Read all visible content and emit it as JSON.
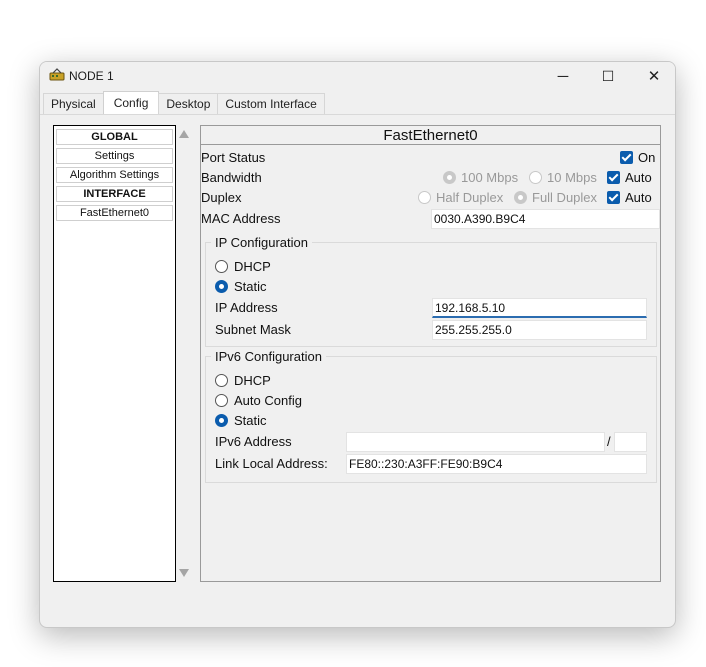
{
  "window": {
    "title": "NODE 1",
    "controls": {
      "minimize": "─",
      "maximize": "☐",
      "close": "✕"
    }
  },
  "tabs": [
    {
      "label": "Physical",
      "active": false
    },
    {
      "label": "Config",
      "active": true
    },
    {
      "label": "Desktop",
      "active": false
    },
    {
      "label": "Custom Interface",
      "active": false
    }
  ],
  "sidebar": {
    "items": [
      {
        "label": "GLOBAL",
        "bold": true
      },
      {
        "label": "Settings",
        "bold": false
      },
      {
        "label": "Algorithm Settings",
        "bold": false
      },
      {
        "label": "INTERFACE",
        "bold": true
      },
      {
        "label": "FastEthernet0",
        "bold": false
      }
    ]
  },
  "panel": {
    "title": "FastEthernet0",
    "port_status": {
      "label": "Port Status",
      "on_label": "On",
      "on": true
    },
    "bandwidth": {
      "label": "Bandwidth",
      "opt_100": "100 Mbps",
      "opt_10": "10 Mbps",
      "auto_label": "Auto",
      "auto": true
    },
    "duplex": {
      "label": "Duplex",
      "opt_half": "Half Duplex",
      "opt_full": "Full Duplex",
      "auto_label": "Auto",
      "auto": true
    },
    "mac": {
      "label": "MAC Address",
      "value": "0030.A390.B9C4"
    },
    "ipv4": {
      "title": "IP Configuration",
      "dhcp_label": "DHCP",
      "static_label": "Static",
      "selected": "Static",
      "ip_label": "IP Address",
      "ip_value": "192.168.5.10",
      "mask_label": "Subnet Mask",
      "mask_value": "255.255.255.0"
    },
    "ipv6": {
      "title": "IPv6 Configuration",
      "dhcp_label": "DHCP",
      "auto_label": "Auto Config",
      "static_label": "Static",
      "selected": "Static",
      "addr_label": "IPv6 Address",
      "addr_value": "",
      "prefix_sep": "/",
      "prefix_value": "",
      "link_local_label": "Link Local Address:",
      "link_local_value": "FE80::230:A3FF:FE90:B9C4"
    }
  },
  "colors": {
    "accent": "#0b5cad",
    "window_bg": "#f0f0f0",
    "focus_underline": "#2b6cb0"
  }
}
